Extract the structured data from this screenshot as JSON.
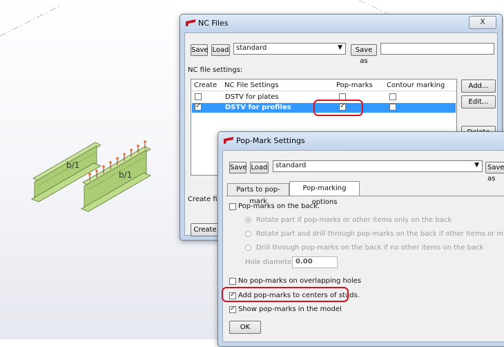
{
  "viewport": {
    "beam1_label": "b/1",
    "beam2_label": "b/1"
  },
  "nc_files": {
    "title": "NC Files",
    "close": "X",
    "save_btn": "Save",
    "load_btn": "Load",
    "preset": "standard",
    "save_as_btn": "Save as",
    "save_as_value": "",
    "section_label": "NC file settings:",
    "columns": {
      "create": "Create",
      "settings": "NC File Settings",
      "pop_marks": "Pop-marks",
      "contour": "Contour marking"
    },
    "rows": [
      {
        "name": "DSTV for plates",
        "create": false,
        "pop_marks": false,
        "contour": false
      },
      {
        "name": "DSTV for profiles",
        "create": true,
        "pop_marks": true,
        "contour": false
      }
    ],
    "add_btn": "Add...",
    "edit_btn": "Edit...",
    "delete_btn": "Delete",
    "create_files_label": "Create files",
    "create_btn": "Create"
  },
  "pop_mark": {
    "title": "Pop-Mark Settings",
    "save_btn": "Save",
    "load_btn": "Load",
    "preset": "standard",
    "save_as_btn": "Save as",
    "tabs": [
      "Parts to pop-mark",
      "Pop-marking options"
    ],
    "back_label": "Pop-marks on the back.",
    "back_checked": false,
    "radio1": "Rotate part if pop-marks or other items only on the back",
    "radio2": "Rotate part and drill through pop-marks on the back if other items or more pop-marks",
    "radio3": "Drill through pop-marks on the back if no other items on the back",
    "hole_label": "Hole diameter",
    "hole_value": "0.00",
    "overlap_label": "No pop-marks on overlapping holes",
    "overlap_checked": false,
    "studs_label": "Add pop-marks to centers of studs.",
    "studs_checked": true,
    "show_label": "Show pop-marks in the model",
    "show_checked": true,
    "ok_btn": "OK"
  },
  "colors": {
    "highlight": "#d4111f",
    "selection": "#3399ff",
    "beam": "#a9cc74"
  }
}
